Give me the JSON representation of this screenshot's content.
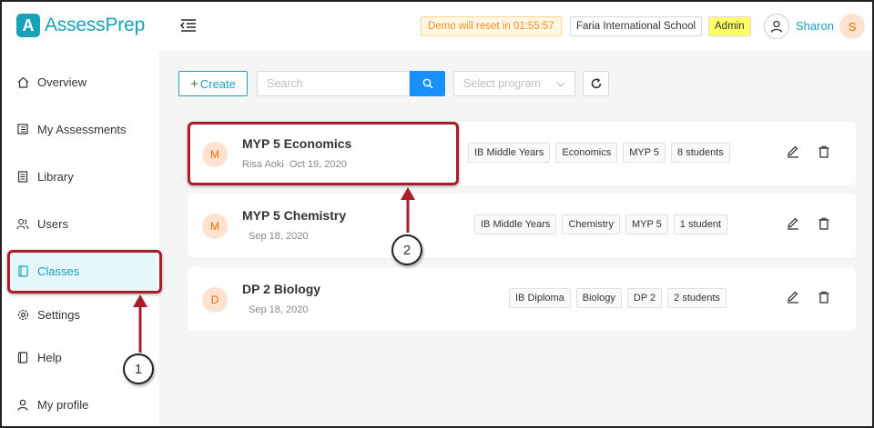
{
  "app": {
    "logo_letter": "A",
    "logo_text": "AssessPrep"
  },
  "header": {
    "demo_text": "Demo will reset in 01:55:57",
    "school": "Faria International School",
    "role": "Admin",
    "user_name": "Sharon",
    "user_initial": "S"
  },
  "sidebar": {
    "items": [
      {
        "label": "Overview",
        "icon": "home-icon"
      },
      {
        "label": "My Assessments",
        "icon": "assessment-icon"
      },
      {
        "label": "Library",
        "icon": "library-icon"
      },
      {
        "label": "Users",
        "icon": "users-icon"
      },
      {
        "label": "Classes",
        "icon": "classes-icon",
        "active": true
      },
      {
        "label": "Settings",
        "icon": "gear-icon"
      },
      {
        "label": "Help",
        "icon": "help-icon"
      },
      {
        "label": "My profile",
        "icon": "user-icon"
      }
    ]
  },
  "toolbar": {
    "create_label": "Create",
    "search_placeholder": "Search",
    "program_placeholder": "Select program"
  },
  "classes": [
    {
      "initial": "M",
      "title": "MYP 5 Economics",
      "owner": "Risa Aoki",
      "date": "Oct 19, 2020",
      "tags": [
        "IB Middle Years",
        "Economics",
        "MYP 5",
        "8 students"
      ]
    },
    {
      "initial": "M",
      "title": "MYP 5 Chemistry",
      "owner": "",
      "date": "Sep 18, 2020",
      "tags": [
        "IB Middle Years",
        "Chemistry",
        "MYP 5",
        "1 student"
      ]
    },
    {
      "initial": "D",
      "title": "DP 2 Biology",
      "owner": "",
      "date": "Sep 18, 2020",
      "tags": [
        "IB Diploma",
        "Biology",
        "DP 2",
        "2 students"
      ]
    }
  ],
  "annotations": {
    "callout_1": "1",
    "callout_2": "2",
    "highlight_color": "#a81d2a"
  },
  "colors": {
    "brand": "#17a2b8",
    "primary": "#1890ff",
    "avatar_bg": "#fde3cf",
    "avatar_fg": "#f56a00"
  }
}
